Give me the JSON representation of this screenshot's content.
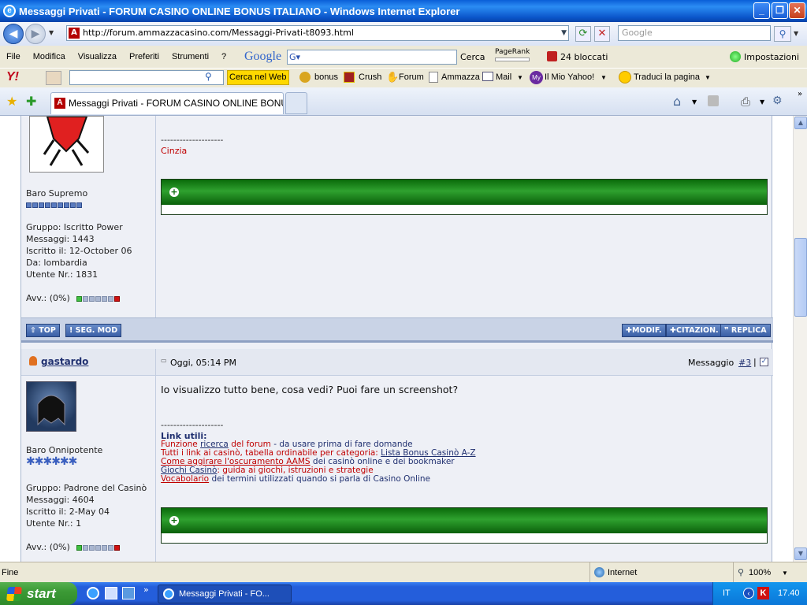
{
  "window": {
    "title": "Messaggi Privati - FORUM CASINO ONLINE BONUS ITALIANO - Windows Internet Explorer"
  },
  "address": {
    "url": "http://forum.ammazzacasino.com/Messaggi-Privati-t8093.html",
    "search_placeholder": "Google"
  },
  "menu": {
    "items": [
      "File",
      "Modifica",
      "Visualizza",
      "Preferiti",
      "Strumenti",
      "?"
    ]
  },
  "google_bar": {
    "brand": "Google",
    "search_label": "Cerca",
    "pagerank": "PageRank",
    "blocked": "24 bloccati",
    "settings": "Impostazioni"
  },
  "yahoo_bar": {
    "brand": "Y!",
    "search_btn": "Cerca nel Web",
    "items": [
      "bonus",
      "Crush",
      "Forum",
      "Ammazza",
      "Mail",
      "Il Mio Yahoo!",
      "Traduci la pagina"
    ]
  },
  "tab": {
    "title": "Messaggi Privati - FORUM CASINO ONLINE BONUS IT..."
  },
  "post1": {
    "signature_sep": "--------------------",
    "signature_name": "Cinzia",
    "rank": "Baro Supremo",
    "group": "Gruppo: Iscritto Power",
    "messages": "Messaggi: 1443",
    "joined": "Iscritto il: 12-October 06",
    "from": "Da: lombardia",
    "user_nr": "Utente Nr.: 1831",
    "warnings": "Avv.: (0%)",
    "warn_pct": 0
  },
  "buttons": {
    "top": "TOP",
    "report": "SEG. MOD",
    "edit": "MODIF.",
    "quote": "CITAZION.",
    "reply": "REPLICA"
  },
  "post2": {
    "author": "gastardo",
    "date": "Oggi, 05:14 PM",
    "msg_label": "Messaggio",
    "msg_num": "#3",
    "body": "Io visualizzo tutto bene, cosa vedi? Puoi fare un screenshot?",
    "sep": "--------------------",
    "links_title": "Link utili:",
    "l1a": "Funzione ",
    "l1b": "ricerca",
    "l1c": " del forum",
    "l1d": " - da usare prima di fare domande",
    "l2a": "Tutti i link ai casinò, tabella ordinabile per categoria: ",
    "l2b": "Lista Bonus Casinò A-Z",
    "l3a": "Come aggirare l'oscuramento AAMS",
    "l3b": " dei casinò online e dei bookmaker",
    "l4a": "Giochi Casinò",
    "l4b": ": guida ai giochi, istruzioni e strategie",
    "l5a": "Vocabolario",
    "l5b": " dei termini utilizzati quando si parla di Casino Online",
    "rank": "Baro Onnipotente",
    "group": "Gruppo: Padrone del Casinò",
    "messages": "Messaggi: 4604",
    "joined": "Iscritto il: 2-May 04",
    "user_nr": "Utente Nr.: 1",
    "warnings": "Avv.: (0%)",
    "warn_pct": 0
  },
  "status": {
    "text": "Fine",
    "zone": "Internet",
    "zoom": "100%"
  },
  "taskbar": {
    "start": "start",
    "item": "Messaggi Privati - FO...",
    "lang": "IT",
    "clock": "17.40"
  }
}
